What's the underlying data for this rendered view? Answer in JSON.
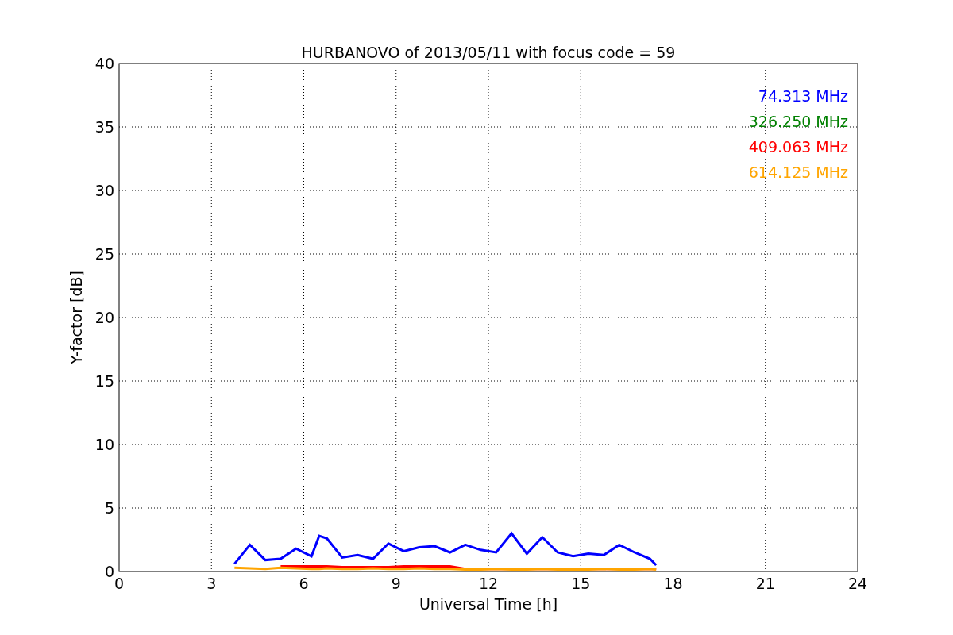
{
  "chart_data": {
    "type": "line",
    "title": "HURBANOVO of 2013/05/11 with focus code = 59",
    "xlabel": "Universal Time [h]",
    "ylabel": "Y-factor [dB]",
    "x": [
      3.75,
      4.25,
      4.75,
      5.25,
      5.75,
      6.25,
      6.5,
      6.75,
      7.25,
      7.75,
      8.25,
      8.75,
      9.25,
      9.75,
      10.25,
      10.75,
      11.25,
      11.75,
      12.25,
      12.75,
      13.25,
      13.75,
      14.25,
      14.75,
      15.25,
      15.75,
      16.25,
      16.75,
      17.25,
      17.45
    ],
    "series": [
      {
        "name": "74.313 MHz",
        "color": "#0000ff",
        "values": [
          0.6,
          2.1,
          0.9,
          1.0,
          1.8,
          1.2,
          2.8,
          2.6,
          1.1,
          1.3,
          1.0,
          2.2,
          1.6,
          1.9,
          2.0,
          1.5,
          2.1,
          1.7,
          1.5,
          3.0,
          1.4,
          2.7,
          1.5,
          1.2,
          1.4,
          1.3,
          2.1,
          1.5,
          1.0,
          0.5
        ]
      },
      {
        "name": "326.250 MHz",
        "color": "#008000",
        "values": [
          null,
          null,
          null,
          null,
          null,
          null,
          null,
          null,
          null,
          null,
          null,
          null,
          null,
          null,
          null,
          null,
          null,
          null,
          null,
          null,
          null,
          null,
          null,
          null,
          null,
          null,
          null,
          null,
          null,
          null
        ]
      },
      {
        "name": "409.063 MHz",
        "color": "#ff0000",
        "values": [
          null,
          null,
          null,
          0.4,
          0.4,
          0.4,
          0.4,
          0.4,
          0.35,
          0.35,
          0.35,
          0.35,
          0.4,
          0.4,
          0.4,
          0.4,
          0.2,
          0.2,
          0.2,
          0.2,
          0.2,
          0.2,
          0.2,
          0.2,
          0.2,
          0.2,
          0.2,
          0.2,
          0.2,
          0.2
        ]
      },
      {
        "name": "614.125 MHz",
        "color": "#ffa500",
        "values": [
          0.3,
          0.25,
          0.2,
          0.3,
          0.25,
          0.2,
          0.2,
          0.25,
          0.2,
          0.2,
          0.25,
          0.2,
          0.2,
          0.25,
          0.2,
          0.2,
          0.15,
          0.15,
          0.2,
          0.15,
          0.15,
          0.2,
          0.15,
          0.15,
          0.15,
          0.2,
          0.15,
          0.15,
          0.2,
          0.15
        ]
      }
    ],
    "xlim": [
      0,
      24
    ],
    "ylim": [
      0,
      40
    ],
    "xticks": [
      0,
      3,
      6,
      9,
      12,
      15,
      18,
      21,
      24
    ],
    "yticks": [
      0,
      5,
      10,
      15,
      20,
      25,
      30,
      35,
      40
    ],
    "grid": true
  }
}
